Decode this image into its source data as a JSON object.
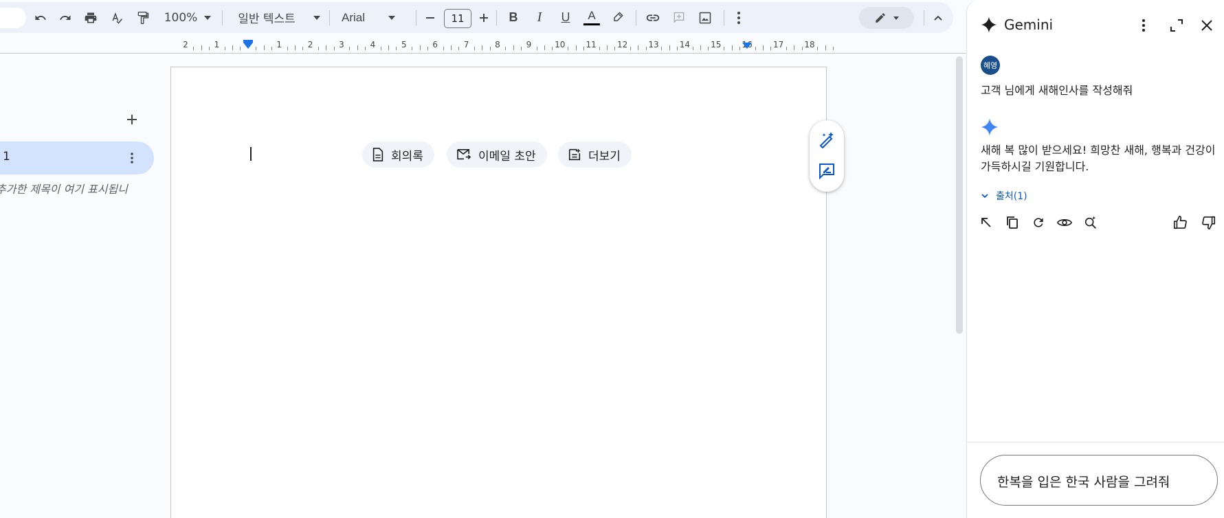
{
  "toolbar": {
    "zoom": "100%",
    "style": "일반 텍스트",
    "font": "Arial",
    "font_size": "11",
    "icons": [
      "undo-icon",
      "redo-icon",
      "print-icon",
      "spellcheck-icon",
      "paint-format-icon",
      "minus-icon",
      "plus-icon",
      "bold-icon",
      "italic-icon",
      "underline-icon",
      "text-color-icon",
      "highlight-icon",
      "link-icon",
      "add-comment-icon",
      "insert-image-icon",
      "more-vert-icon",
      "edit-mode-icon",
      "collapse-icon"
    ],
    "text_color": "#000000"
  },
  "ruler": {
    "labels": [
      "2",
      "1",
      "",
      "1",
      "2",
      "3",
      "4",
      "5",
      "6",
      "7",
      "8",
      "9",
      "10",
      "11",
      "12",
      "13",
      "14",
      "15",
      "16",
      "17",
      "18"
    ]
  },
  "outline": {
    "tab_label": "1",
    "hint": "추가한 제목이 여기 표시됩니"
  },
  "document": {
    "chips": [
      {
        "label": "회의록",
        "icon": "document-icon"
      },
      {
        "label": "이메일 초안",
        "icon": "email-draft-icon"
      },
      {
        "label": "더보기",
        "icon": "more-docs-icon"
      }
    ]
  },
  "gemini": {
    "title": "Gemini",
    "user_avatar": "혜영",
    "user_message": "고객 님에게 새해인사를 작성해줘",
    "answer": "새해 복 많이 받으세요! 희망찬 새해, 행복과 건강이 가득하시길 기원합니다.",
    "sources_label": "출처(1)",
    "prompt_text": "한복을 입은 한국 사람을 그려줘",
    "accent": "#0b57d0"
  }
}
